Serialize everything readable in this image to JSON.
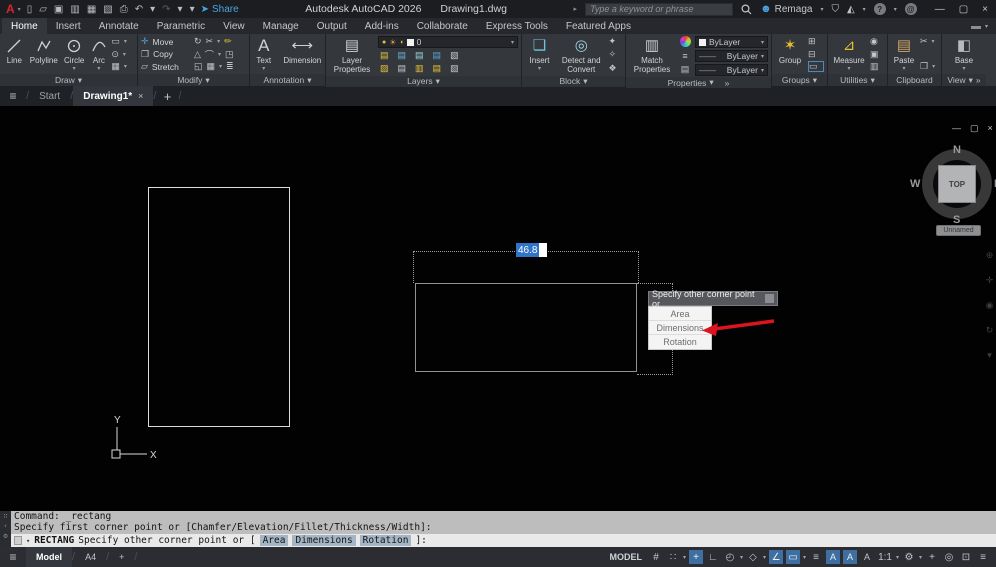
{
  "colors": {
    "accent_blue": "#2f74c8",
    "toggle_blue": "#3f6ea0",
    "arrow_red": "#dc1420",
    "canvas_bg": "#020202"
  },
  "titlebar": {
    "share_label": "Share",
    "app_title": "Autodesk AutoCAD 2026",
    "doc_title": "Drawing1.dwg",
    "search_placeholder": "Type a keyword or phrase",
    "user_name": "Remaga"
  },
  "ribbon_tabs": {
    "items": [
      "Home",
      "Insert",
      "Annotate",
      "Parametric",
      "View",
      "Manage",
      "Output",
      "Add-ins",
      "Collaborate",
      "Express Tools",
      "Featured Apps"
    ]
  },
  "ribbon": {
    "draw": {
      "label": "Draw",
      "b1": "Line",
      "b2": "Polyline",
      "b3": "Circle",
      "b4": "Arc"
    },
    "modify": {
      "label": "Modify",
      "b1": "Move",
      "b2": "Copy",
      "b3": "Stretch"
    },
    "annotation": {
      "label": "Annotation",
      "b1": "Text",
      "b2": "Dimension"
    },
    "layers": {
      "label": "Layers",
      "b1": "Layer Properties",
      "current_layer": "0"
    },
    "block": {
      "label": "Block",
      "b1": "Insert",
      "b2": "Detect and Convert"
    },
    "properties": {
      "label": "Properties",
      "b1": "Match Properties",
      "v1": "ByLayer",
      "v2": "ByLayer",
      "v3": "ByLayer"
    },
    "groups": {
      "label": "Groups",
      "b1": "Group"
    },
    "utilities": {
      "label": "Utilities",
      "b1": "Measure"
    },
    "clipboard": {
      "label": "Clipboard",
      "b1": "Paste"
    },
    "view": {
      "label": "View",
      "b1": "Base"
    }
  },
  "file_tabs": {
    "start": "Start",
    "active": "Drawing1*"
  },
  "canvas": {
    "dyn_input": "46.8",
    "menu": {
      "header": "Specify other corner point or",
      "i1": "Area",
      "i2": "Dimensions",
      "i3": "Rotation"
    },
    "viewcube": {
      "n": "N",
      "s": "S",
      "w": "W",
      "e": "E",
      "face": "TOP",
      "ucs": "Unnamed"
    },
    "axes": {
      "x": "X",
      "y": "Y"
    }
  },
  "cmd": {
    "line1": "Command: _rectang",
    "line2": "Specify first corner point or [Chamfer/Elevation/Fillet/Thickness/Width]:",
    "cmd_name": "RECTANG",
    "prompt": "Specify other corner point or [",
    "o1": "Area",
    "o2": "Dimensions",
    "o3": "Rotation",
    "suffix": "]:"
  },
  "status": {
    "model": "Model",
    "layout": "A4",
    "mode": "MODEL",
    "scale": "1:1"
  }
}
